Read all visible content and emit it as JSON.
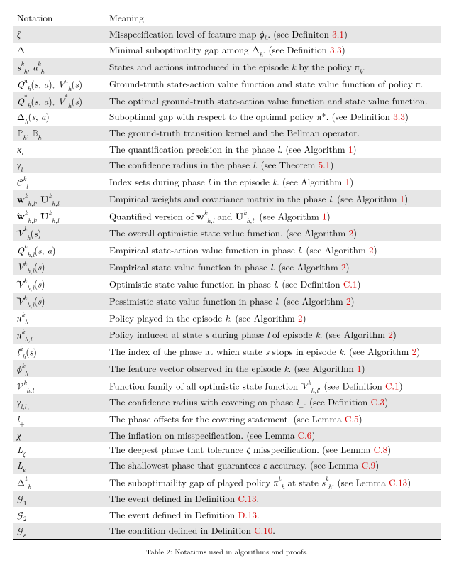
{
  "header": {
    "notation": "Notation",
    "meaning": "Meaning"
  },
  "caption": "Table 2: Notations used in algorithms and proofs.",
  "rows": [
    {
      "notation_html": "<span class='it'>ζ</span>",
      "meaning_plain": "Misspecification level of feature map ",
      "meaning_math": "<span class='it'>ϕ</span><span class='sub it'>h</span>",
      "meaning_tail": ". (see Definiton ",
      "ref": "3.1",
      "rparen": ")"
    },
    {
      "notation_html": "<span>Δ</span>",
      "meaning_plain": "Minimal suboptimality gap among ",
      "meaning_math": "Δ<span class='sub it'>h</span>",
      "meaning_tail": ". (see Definition ",
      "ref": "3.3",
      "rparen": ")"
    },
    {
      "notation_html": "<span class='it'>s</span><span class='sup it'>k</span><span class='sub it'>h</span>, <span class='it'>a</span><span class='sup it'>k</span><span class='sub it'>h</span>",
      "meaning_plain": "States and actions introduced in the episode ",
      "meaning_math": "<span class='it'>k</span>",
      "meaning_tail": " by the policy π<span class='sub it'>k</span>.",
      "ref": "",
      "rparen": ""
    },
    {
      "notation_html": "<span class='it'>Q</span><span class='sup it'>π</span><span class='sub it'>h</span>(<span class='it'>s</span>, <span class='it'>a</span>), <span class='it'>V</span><span class='sup it'>π</span><span class='sub it'>h</span>(<span class='it'>s</span>)",
      "meaning_plain": "Ground-truth state-action value function and state value function of policy π.",
      "meaning_math": "",
      "meaning_tail": "",
      "ref": "",
      "rparen": ""
    },
    {
      "notation_html": "<span class='it'>Q</span><span class='sup'>*</span><span class='sub it'>h</span>(<span class='it'>s</span>, <span class='it'>a</span>), <span class='it'>V</span><span class='sup'>*</span><span class='sub it'>h</span>(<span class='it'>s</span>)",
      "meaning_plain": "The optimal ground-truth state-action value function and state value function.",
      "meaning_math": "",
      "meaning_tail": "",
      "ref": "",
      "rparen": ""
    },
    {
      "notation_html": "Δ<span class='sub it'>h</span>(<span class='it'>s</span>, <span class='it'>a</span>)",
      "meaning_plain": "Suboptimal gap with respect to the optimal policy π*. (see Definition ",
      "meaning_math": "",
      "meaning_tail": "",
      "ref": "3.3",
      "rparen": ")"
    },
    {
      "notation_html": "<span class='bb'>ℙ</span><span class='sub it'>h</span>, <span class='bb'>𝔹</span><span class='sub it'>h</span>",
      "meaning_plain": "The ground-truth transition kernel and the Bellman operator.",
      "meaning_math": "",
      "meaning_tail": "",
      "ref": "",
      "rparen": ""
    },
    {
      "notation_html": "<span class='it'>κ</span><span class='sub it'>l</span>",
      "meaning_plain": "The quantification precision in the phase ",
      "meaning_math": "<span class='it'>l</span>",
      "meaning_tail": ". (see Algorithm ",
      "ref": "1",
      "rparen": ")"
    },
    {
      "notation_html": "<span class='it'>γ</span><span class='sub it'>l</span>",
      "meaning_plain": "The confidence radius in the phase ",
      "meaning_math": "<span class='it'>l</span>",
      "meaning_tail": ". (see Theorem ",
      "ref": "5.1",
      "rparen": ")"
    },
    {
      "notation_html": "<span class='cal'>𝒞</span><span class='sup it'>k</span><span class='sub it'>l</span>",
      "meaning_plain": "Index sets during phase ",
      "meaning_math": "<span class='it'>l</span>",
      "meaning_tail": " in the episode <span class='it'>k</span>. (see Algorithm ",
      "ref": "1",
      "rparen": ")"
    },
    {
      "notation_html": "<span class='bf'>w</span><span class='sup it'>k</span><span class='sub it'>h,l</span>, <span class='bf'>U</span><span class='sup it'>k</span><span class='sub it'>h,l</span>",
      "meaning_plain": "Empirical weights and covariance matrix in the phase ",
      "meaning_math": "<span class='it'>l</span>",
      "meaning_tail": ". (see Algorithm ",
      "ref": "1",
      "rparen": ")"
    },
    {
      "notation_html": "<span class='hat'><span class='bf'>w</span></span><span class='sup it'>k</span><span class='sub it'>h,l</span>, <span class='hat'><span class='bf'>U</span></span><span class='sup it'>k</span><span class='sub it'>h,l</span>",
      "meaning_plain": "Quantified version of ",
      "meaning_math": "<span class='bf'>w</span><span class='sup it'>k</span><span class='sub it'>h,l</span> and <span class='bf'>U</span><span class='sup it'>k</span><span class='sub it'>h,l</span>",
      "meaning_tail": ". (see Algorithm ",
      "ref": "1",
      "rparen": ")"
    },
    {
      "notation_html": "<span class='hat'><span class='it'>V</span></span><span class='sup it'>k</span><span class='sub it'>h</span>(<span class='it'>s</span>)",
      "meaning_plain": "The overall optimistic state value function. (see Algorithm ",
      "meaning_math": "",
      "meaning_tail": "",
      "ref": "2",
      "rparen": ")"
    },
    {
      "notation_html": "<span class='it'>Q</span><span class='sup it'>k</span><span class='sub it'>h,l</span>(<span class='it'>s</span>, <span class='it'>a</span>)",
      "meaning_plain": "Empirical state-action value function in phase ",
      "meaning_math": "<span class='it'>l</span>",
      "meaning_tail": ". (see Algorithm ",
      "ref": "2",
      "rparen": ")"
    },
    {
      "notation_html": "<span class='it'>V</span><span class='sup it'>k</span><span class='sub it'>h,l</span>(<span class='it'>s</span>)",
      "meaning_plain": "Empirical state value function in phase ",
      "meaning_math": "<span class='it'>l</span>",
      "meaning_tail": ". (see Algorithm ",
      "ref": "2",
      "rparen": ")"
    },
    {
      "notation_html": "<span class='hat'><span class='it'>V</span></span><span class='sup it'>k</span><span class='sub it'>h,l</span>(<span class='it'>s</span>)",
      "meaning_plain": "Optimistic state value function in phase ",
      "meaning_math": "<span class='it'>l</span>",
      "meaning_tail": ". (see Definition ",
      "ref": "C.1",
      "rparen": ")"
    },
    {
      "notation_html": "<span class='check'><span class='it'>V</span></span><span class='sup it'>k</span><span class='sub it'>h,l</span>(<span class='it'>s</span>)",
      "meaning_plain": "Pessimistic state value function in phase ",
      "meaning_math": "<span class='it'>l</span>",
      "meaning_tail": ". (see Algorithm ",
      "ref": "2",
      "rparen": ")"
    },
    {
      "notation_html": "<span class='it'>π</span><span class='sup it'>k</span><span class='sub it'>h</span>",
      "meaning_plain": "Policy played in the episode ",
      "meaning_math": "<span class='it'>k</span>",
      "meaning_tail": ". (see Algorithm ",
      "ref": "2",
      "rparen": ")"
    },
    {
      "notation_html": "<span class='it'>π</span><span class='sup it'>k</span><span class='sub it'>h,l</span>",
      "meaning_plain": "Policy induced at state ",
      "meaning_math": "<span class='it'>s</span>",
      "meaning_tail": " during phase <span class='it'>l</span> of episode <span class='it'>k</span>. (see Algorithm ",
      "ref": "2",
      "rparen": ")"
    },
    {
      "notation_html": "<span class='it'>l</span><span class='sup it'>k</span><span class='sub it'>h</span>(<span class='it'>s</span>)",
      "meaning_plain": "The index of the phase at which state ",
      "meaning_math": "<span class='it'>s</span>",
      "meaning_tail": " stops in episode <span class='it'>k</span>. (see Algorithm ",
      "ref": "2",
      "rparen": ")"
    },
    {
      "notation_html": "<span class='it'>ϕ</span><span class='sup it'>k</span><span class='sub it'>h</span>",
      "meaning_plain": "The feature vector observed in the episode ",
      "meaning_math": "<span class='it'>k</span>",
      "meaning_tail": ". (see Algorithm ",
      "ref": "1",
      "rparen": ")"
    },
    {
      "notation_html": "<span class='cal'>𝒱</span><span class='sup it'>k</span><span class='sub it'>h,l</span>",
      "meaning_plain": "Function family of all optimistic state function ",
      "meaning_math": "<span class='hat'><span class='it'>V</span></span><span class='sup it'>k</span><span class='sub it'>h,l</span>",
      "meaning_tail": ". (see Definition ",
      "ref": "C.1",
      "rparen": ")"
    },
    {
      "notation_html": "<span class='it'>γ</span><span class='sub it'>l,l<span class='sub'>+</span></span>",
      "meaning_plain": "The confidence radius with covering on phase ",
      "meaning_math": "<span class='it'>l</span><span class='sub'>+</span>",
      "meaning_tail": ". (see Definition ",
      "ref": "C.3",
      "rparen": ")"
    },
    {
      "notation_html": "<span class='it'>l</span><span class='sub'>+</span>",
      "meaning_plain": "The phase offsets for the covering statement. (see Lemma ",
      "meaning_math": "",
      "meaning_tail": "",
      "ref": "C.5",
      "rparen": ")"
    },
    {
      "notation_html": "<span class='it'>χ</span>",
      "meaning_plain": "The inflation on misspecification. (see Lemma ",
      "meaning_math": "",
      "meaning_tail": "",
      "ref": "C.6",
      "rparen": ")"
    },
    {
      "notation_html": "<span class='it'>L</span><span class='sub it'>ζ</span>",
      "meaning_plain": "The deepest phase that tolerance ",
      "meaning_math": "<span class='it'>ζ</span>",
      "meaning_tail": " misspecification. (see Lemma ",
      "ref": "C.8",
      "rparen": ")"
    },
    {
      "notation_html": "<span class='it'>L</span><span class='sub it'>ε</span>",
      "meaning_plain": "The shallowest phase that guarantees ",
      "meaning_math": "<span class='it'>ε</span>",
      "meaning_tail": " accuracy. (see Lemma ",
      "ref": "C.9",
      "rparen": ")"
    },
    {
      "notation_html": "Δ<span class='sup it'>k</span><span class='sub it'>h</span>",
      "meaning_plain": "The suboptimaility gap of played policy ",
      "meaning_math": "<span class='it'>π</span><span class='sup it'>k</span><span class='sub it'>h</span> at state <span class='it'>s</span><span class='sup it'>k</span><span class='sub it'>h</span>",
      "meaning_tail": ". (see Lemma ",
      "ref": "C.13",
      "rparen": ")"
    },
    {
      "notation_html": "<span class='cal'>𝒢</span><span class='sub'>1</span>",
      "meaning_plain": "The event defined in Definition ",
      "meaning_math": "",
      "meaning_tail": "",
      "ref": "C.13",
      "rparen": "."
    },
    {
      "notation_html": "<span class='cal'>𝒢</span><span class='sub'>2</span>",
      "meaning_plain": "The event defined in Definition ",
      "meaning_math": "",
      "meaning_tail": "",
      "ref": "D.13",
      "rparen": "."
    },
    {
      "notation_html": "<span class='cal'>𝒢</span><span class='sub it'>ε</span>",
      "meaning_plain": "The condition defined in Definition ",
      "meaning_math": "",
      "meaning_tail": "",
      "ref": "C.10",
      "rparen": "."
    }
  ]
}
